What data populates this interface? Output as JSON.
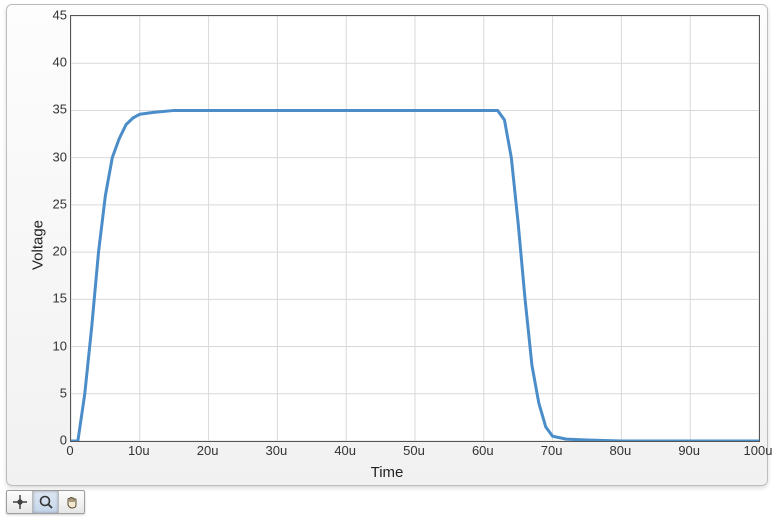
{
  "chart_data": {
    "type": "line",
    "title": "",
    "xlabel": "Time",
    "ylabel": "Voltage",
    "xlim": [
      0,
      100
    ],
    "ylim": [
      0,
      45
    ],
    "x_unit_suffix": "u",
    "x_ticks": [
      0,
      10,
      20,
      30,
      40,
      50,
      60,
      70,
      80,
      90,
      100
    ],
    "y_ticks": [
      0,
      5,
      10,
      15,
      20,
      25,
      30,
      35,
      40,
      45
    ],
    "grid": true,
    "series": [
      {
        "name": "Voltage",
        "x": [
          0,
          1,
          2,
          3,
          4,
          5,
          6,
          7,
          8,
          9,
          10,
          12,
          15,
          20,
          25,
          30,
          35,
          40,
          45,
          50,
          55,
          60,
          62,
          63,
          64,
          65,
          66,
          67,
          68,
          69,
          70,
          72,
          75,
          80,
          85,
          90,
          95,
          100
        ],
        "y": [
          0,
          0,
          5,
          12,
          20,
          26,
          30,
          32,
          33.5,
          34.2,
          34.6,
          34.8,
          35,
          35,
          35,
          35,
          35,
          35,
          35,
          35,
          35,
          35,
          35,
          34,
          30,
          23,
          15,
          8,
          4,
          1.5,
          0.5,
          0.2,
          0.1,
          0,
          0,
          0,
          0,
          0
        ]
      }
    ]
  },
  "toolbar": {
    "tools": [
      {
        "name": "crosshair-icon",
        "label": "Cursor"
      },
      {
        "name": "zoom-icon",
        "label": "Zoom"
      },
      {
        "name": "pan-hand-icon",
        "label": "Pan"
      }
    ],
    "active_index": 1
  }
}
